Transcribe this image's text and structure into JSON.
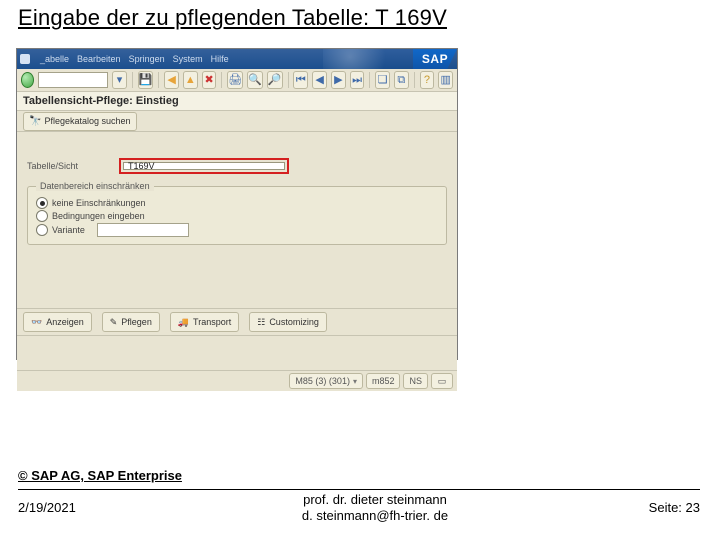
{
  "slide": {
    "title": "Eingabe der zu pflegenden Tabelle: T 169V",
    "copyright": "© SAP AG, SAP Enterprise",
    "date": "2/19/2021",
    "author_line1": "prof. dr. dieter steinmann",
    "author_line2": "d. steinmann@fh-trier. de",
    "page": "Seite: 23"
  },
  "sap": {
    "menu": {
      "table": "_abelle",
      "edit": "Bearbeiten",
      "goto": "Springen",
      "system": "System",
      "help": "Hilfe"
    },
    "logo_text": "SAP",
    "screen_title": "Tabellensicht-Pflege: Einstieg",
    "app_toolbar": {
      "find_viewcat": "Pflegekatalog suchen"
    },
    "field": {
      "label": "Tabelle/Sicht",
      "value": "T169V"
    },
    "group": {
      "title": "Datenbereich einschränken",
      "r1": "keine Einschränkungen",
      "r2": "Bedingungen eingeben",
      "r3": "Variante"
    },
    "actions": {
      "display": "Anzeigen",
      "maintain": "Pflegen",
      "transport": "Transport",
      "customizing": "Customizing"
    },
    "status": {
      "system": "M85 (3) (301)",
      "host": "m852",
      "mode": "NS"
    }
  }
}
